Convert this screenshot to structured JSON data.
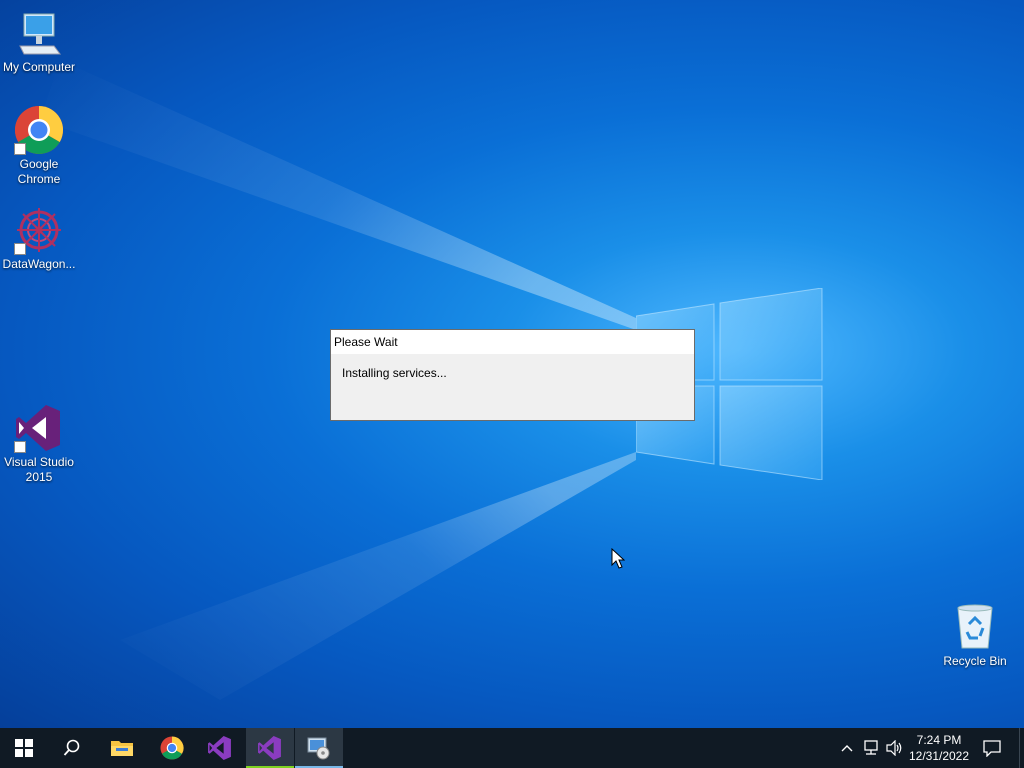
{
  "desktop": {
    "icons": [
      {
        "label": "My Computer",
        "icon": "computer-icon"
      },
      {
        "label": "Google Chrome",
        "icon": "chrome-icon"
      },
      {
        "label": "DataWagon...",
        "icon": "datawagon-icon"
      },
      {
        "label": "Visual Studio 2015",
        "icon": "visual-studio-icon"
      },
      {
        "label": "Recycle Bin",
        "icon": "recycle-bin-icon"
      }
    ]
  },
  "dialog": {
    "title": "Please Wait",
    "message": "Installing services..."
  },
  "taskbar": {
    "apps": [
      {
        "name": "start",
        "icon": "windows-start-icon"
      },
      {
        "name": "search",
        "icon": "search-icon"
      },
      {
        "name": "file-explorer",
        "icon": "folder-icon"
      },
      {
        "name": "chrome",
        "icon": "chrome-icon"
      },
      {
        "name": "visual-studio",
        "icon": "visual-studio-icon"
      },
      {
        "name": "visual-studio-running",
        "icon": "visual-studio-icon",
        "active": true
      },
      {
        "name": "installer",
        "icon": "installer-icon",
        "active": true
      }
    ],
    "tray": {
      "icons": [
        "chevron-up-icon",
        "network-icon",
        "volume-icon"
      ],
      "time": "7:24 PM",
      "date": "12/31/2022",
      "notification_icon": "notification-icon"
    }
  },
  "colors": {
    "desktop_blue": "#0a6fd6",
    "taskbar": "#101a24",
    "vs_purple": "#68217a"
  }
}
